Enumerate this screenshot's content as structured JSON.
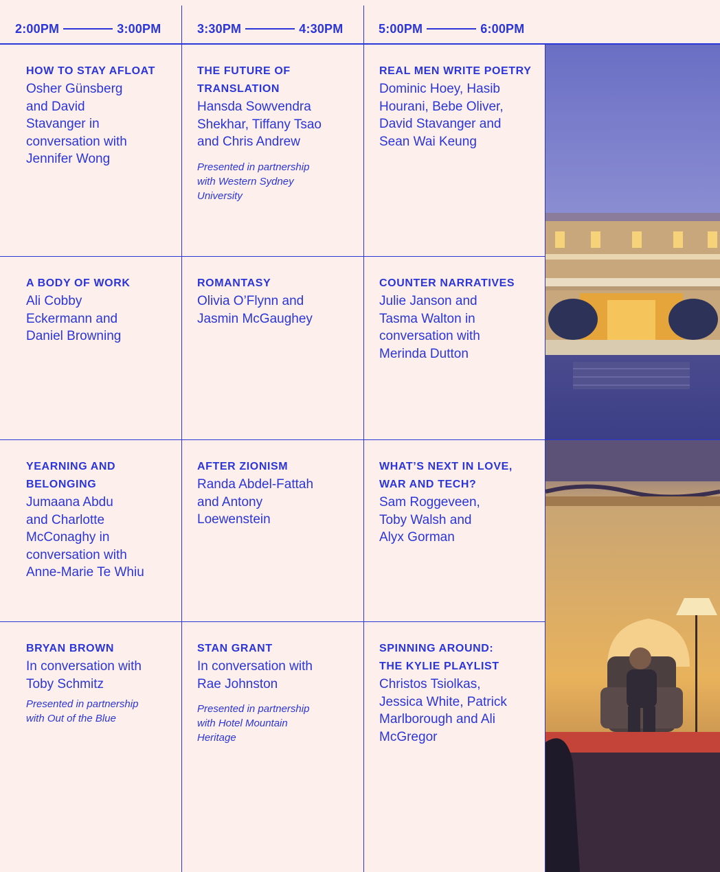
{
  "schedule": {
    "time_slots": [
      {
        "start": "2:00PM",
        "end": "3:00PM"
      },
      {
        "start": "3:30PM",
        "end": "4:30PM"
      },
      {
        "start": "5:00PM",
        "end": "6:00PM"
      }
    ],
    "rows": [
      [
        {
          "title": "How to Stay Afloat",
          "people": "Osher Günsberg\nand David\nStavanger in\nconversation with\nJennifer Wong",
          "note": ""
        },
        {
          "title": "The Future of\nTranslation",
          "people": "Hansda Sowvendra\nShekhar, Tiffany Tsao\nand Chris Andrew",
          "note": "Presented in partnership\nwith Western Sydney\nUniversity"
        },
        {
          "title": "Real Men Write Poetry",
          "people": "Dominic Hoey, Hasib\nHourani, Bebe Oliver,\nDavid Stavanger and\nSean Wai Keung",
          "note": ""
        }
      ],
      [
        {
          "title": "A Body of Work",
          "people": "Ali Cobby\nEckermann and\nDaniel Browning",
          "note": ""
        },
        {
          "title": "Romantasy",
          "people": "Olivia O’Flynn and\nJasmin McGaughey",
          "note": ""
        },
        {
          "title": "Counter Narratives",
          "people": "Julie Janson and\nTasma Walton in\nconversation with\nMerinda Dutton",
          "note": ""
        }
      ],
      [
        {
          "title": "Yearning and\nBelonging",
          "people": "Jumaana Abdu\nand Charlotte\nMcConaghy in\nconversation with\nAnne-Marie Te Whiu",
          "note": ""
        },
        {
          "title": "After Zionism",
          "people": "Randa Abdel-Fattah\nand Antony\nLoewenstein",
          "note": ""
        },
        {
          "title": "What’s Next in Love,\nWar and Tech?",
          "people": "Sam Roggeveen,\nToby Walsh and\nAlyx Gorman",
          "note": ""
        }
      ],
      [
        {
          "title": "Bryan Brown",
          "people": "In conversation with\nToby Schmitz",
          "note": "Presented in partnership\nwith Out of the Blue"
        },
        {
          "title": "Stan Grant",
          "people": "In conversation with\nRae Johnston",
          "note": "Presented in partnership\nwith Hotel Mountain\nHeritage"
        },
        {
          "title": "Spinning Around:\nThe Kylie Playlist",
          "people": "Christos Tsiolkas,\nJessica White, Patrick\nMarlborough and Ali\nMcGregor",
          "note": ""
        }
      ]
    ]
  },
  "colors": {
    "ink": "#2b35d8",
    "background": "#fdf0ec",
    "dusk_sky": "#6f72c0",
    "warm_light": "#f2b040"
  }
}
